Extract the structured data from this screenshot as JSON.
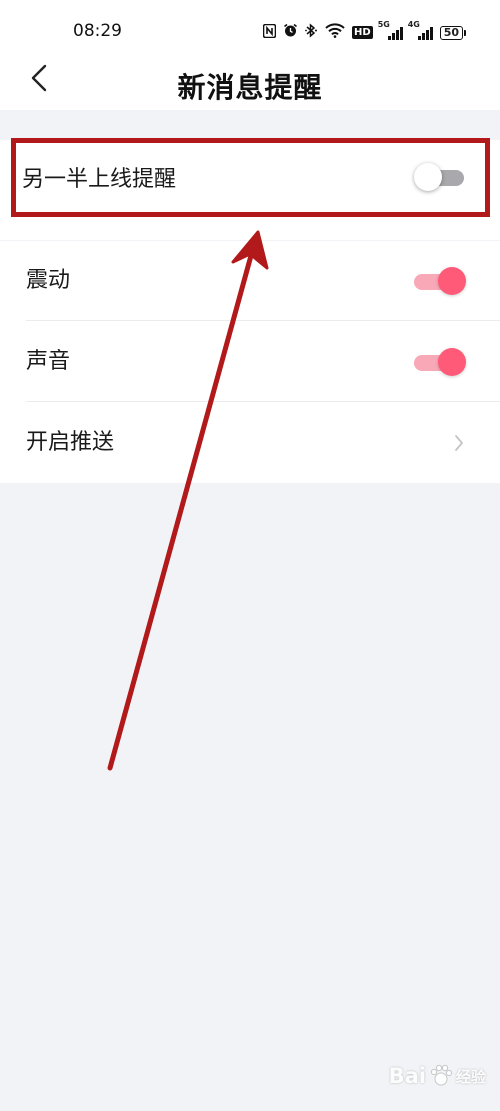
{
  "status_bar": {
    "time": "08:29",
    "icons": [
      "nfc-icon",
      "alarm-icon",
      "bluetooth-icon",
      "wifi-icon",
      "hd-icon",
      "signal-5g-icon",
      "signal-4g-icon",
      "battery-icon"
    ],
    "hd_label": "HD",
    "sim1_label": "5G",
    "sim2_label": "4G",
    "battery_level": "50"
  },
  "header": {
    "title": "新消息提醒",
    "back_icon": "chevron-left-icon"
  },
  "settings": {
    "partner_online": {
      "label": "另一半上线提醒",
      "enabled": false
    },
    "vibration": {
      "label": "震动",
      "enabled": true
    },
    "sound": {
      "label": "声音",
      "enabled": true
    },
    "push": {
      "label": "开启推送",
      "icon": "chevron-right-icon"
    }
  },
  "colors": {
    "toggle_on_knob": "#ff5a78",
    "toggle_on_track": "#f8a8b6",
    "toggle_off_track": "#a9a9ad",
    "annotation": "#b1191b",
    "background": "#f2f3f6"
  },
  "watermark": {
    "brand": "Bai",
    "suffix": "经验"
  }
}
